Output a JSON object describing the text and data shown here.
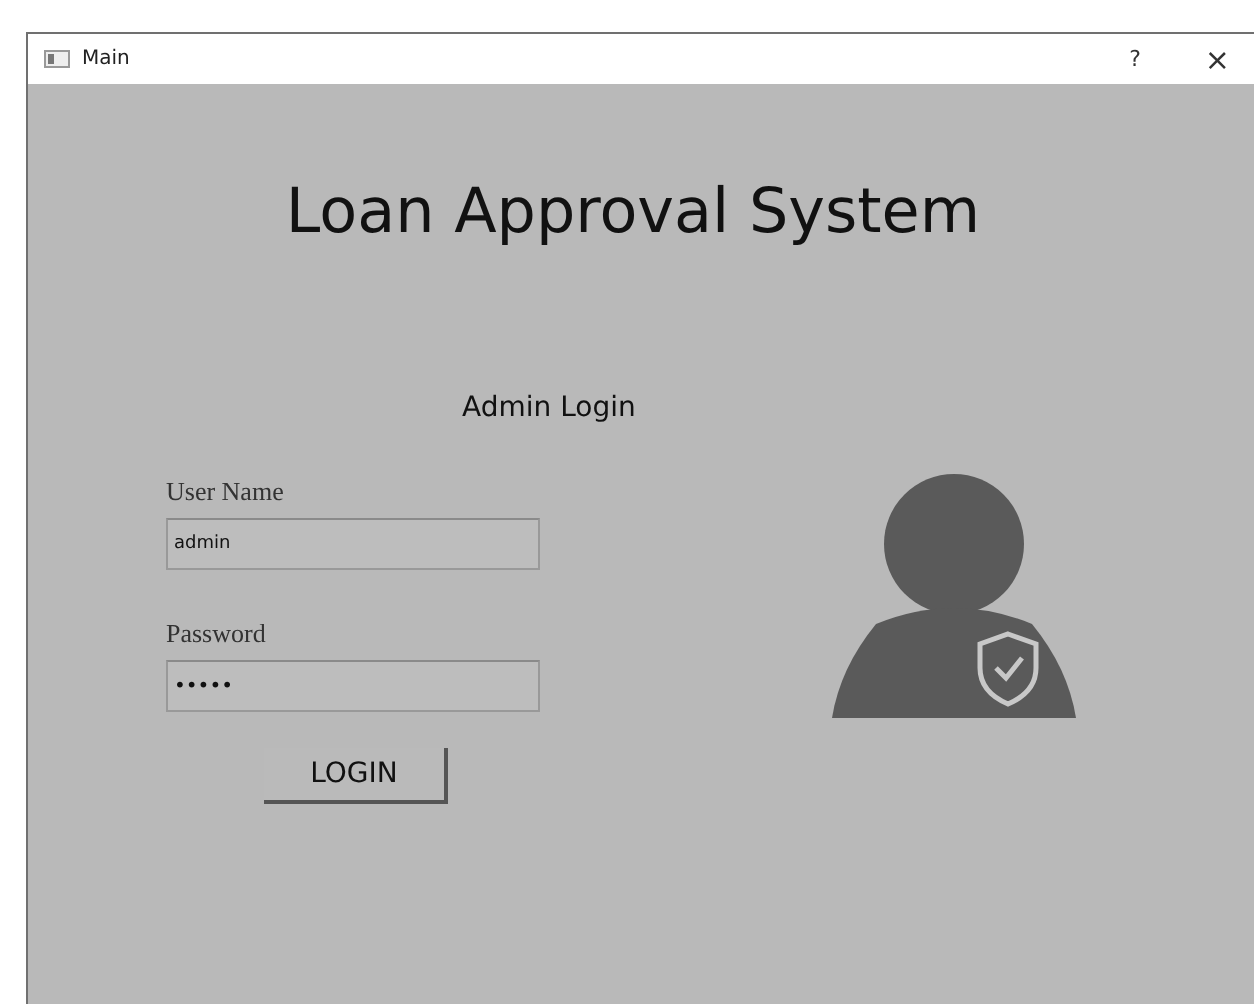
{
  "window": {
    "title": "Main",
    "help_button": "?",
    "close_button": "×"
  },
  "heading": "Loan Approval System",
  "subheading": "Admin Login",
  "form": {
    "fields": [
      {
        "label": "User Name",
        "value": "admin"
      },
      {
        "label": "Password",
        "value": "•••••"
      }
    ],
    "button": "LOGIN"
  }
}
